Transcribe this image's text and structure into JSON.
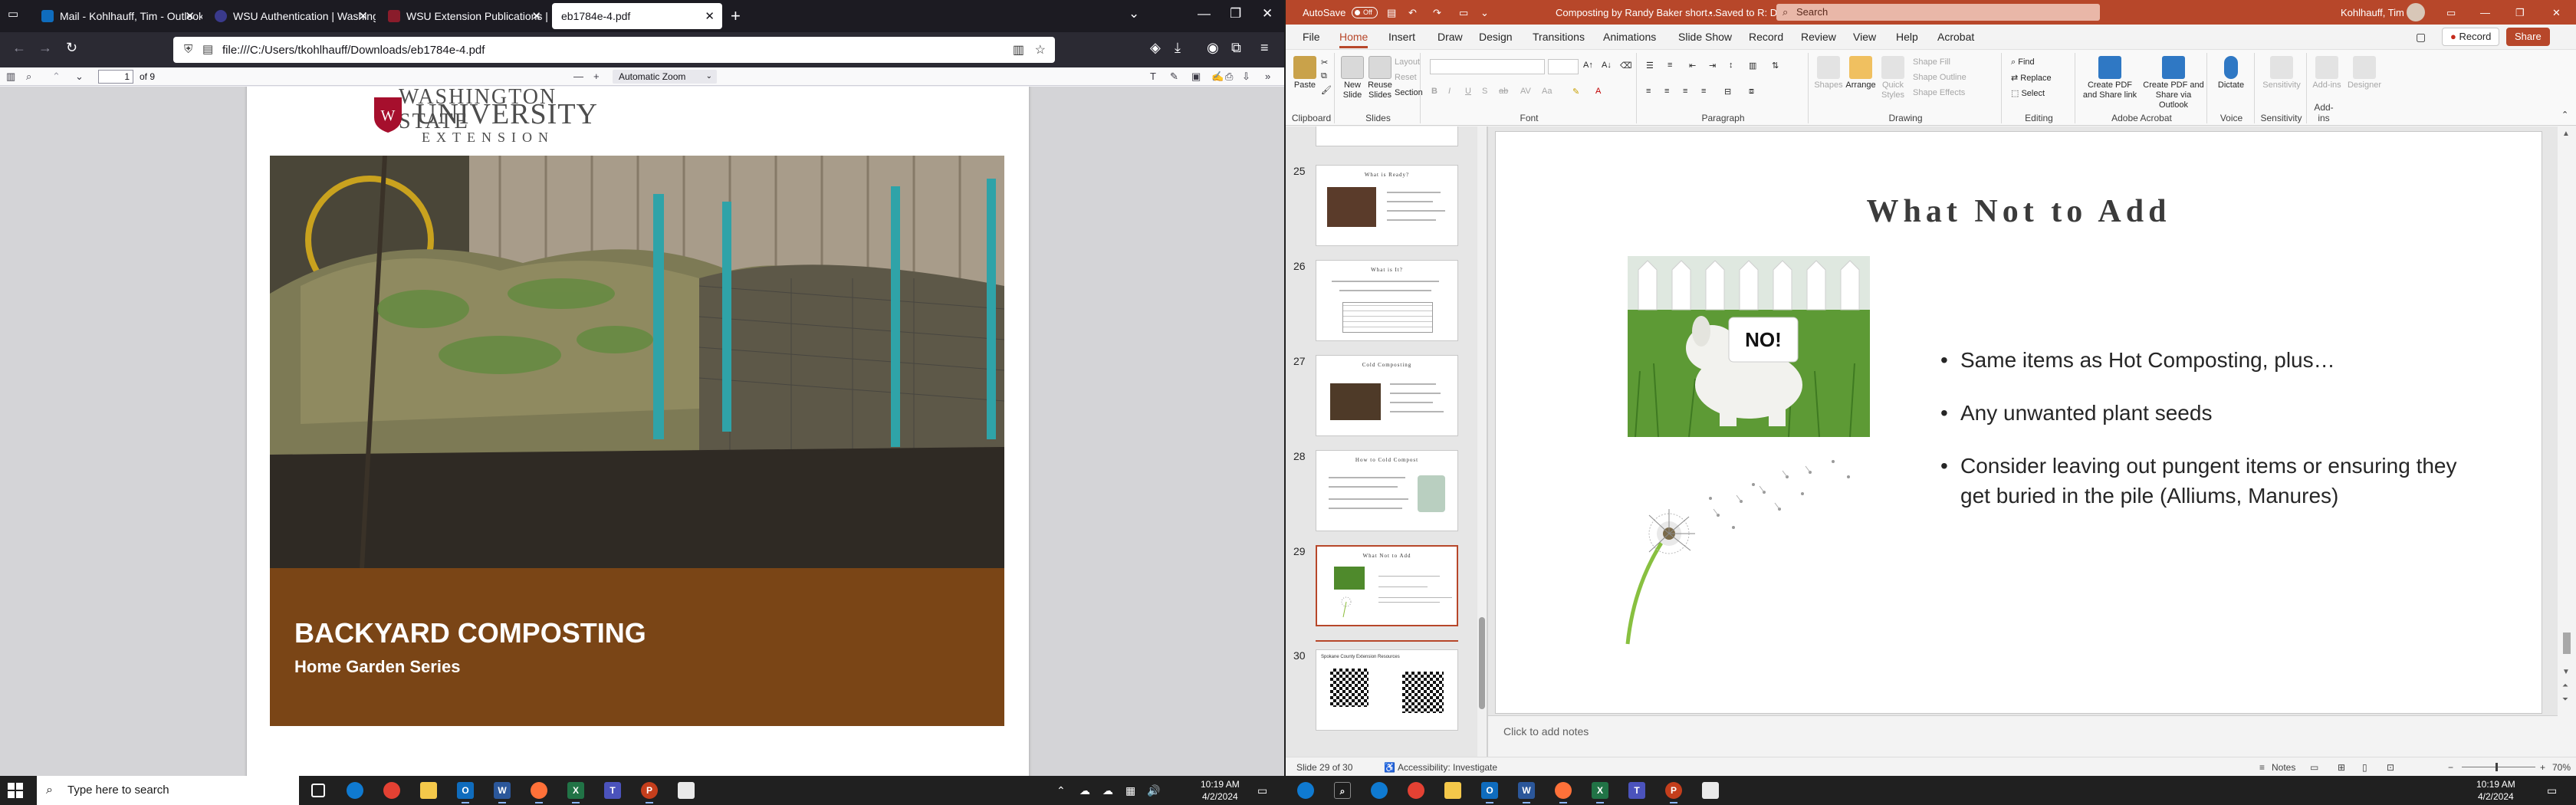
{
  "firefox": {
    "tabs": [
      {
        "label": "Mail - Kohlhauff, Tim - Outlook",
        "color": "#0f6cbd"
      },
      {
        "label": "WSU Authentication | Washington",
        "color": "#3a3a8c"
      },
      {
        "label": "WSU Extension Publications | Bo",
        "color": "#8a1c2b"
      },
      {
        "label": "eb1784e-4.pdf",
        "color": "#c9c9c9"
      }
    ],
    "url": "file:///C:/Users/tkohlhauff/Downloads/eb1784e-4.pdf",
    "pdf_toolbar": {
      "page_number": "1",
      "page_total": "of 9",
      "zoom": "Automatic Zoom"
    },
    "pdf_page": {
      "logo_line1": "WASHINGTON STATE",
      "logo_line2": "UNIVERSITY",
      "logo_line3": "EXTENSION",
      "title": "BACKYARD COMPOSTING",
      "subtitle": "Home Garden Series",
      "band_color": "#7a4516"
    }
  },
  "powerpoint": {
    "autosave_label": "AutoSave",
    "autosave_state": "Off",
    "doc_title": "Composting by Randy Baker short...",
    "saved_status": "• Saved to R: Drive",
    "search_placeholder": "Search",
    "user_name": "Kohlhauff, Tim",
    "menu": [
      "File",
      "Home",
      "Insert",
      "Draw",
      "Design",
      "Transitions",
      "Animations",
      "Slide Show",
      "Record",
      "Review",
      "View",
      "Help",
      "Acrobat"
    ],
    "active_menu": "Home",
    "record_button": "Record",
    "share_button": "Share",
    "ribbon": {
      "clipboard": {
        "label": "Clipboard",
        "paste": "Paste"
      },
      "slides": {
        "label": "Slides",
        "new_slide": "New Slide",
        "reuse": "Reuse Slides",
        "layout": "Layout",
        "reset": "Reset",
        "section": "Section"
      },
      "font": {
        "label": "Font"
      },
      "paragraph": {
        "label": "Paragraph"
      },
      "drawing": {
        "label": "Drawing",
        "shapes": "Shapes",
        "arrange": "Arrange",
        "quick_styles": "Quick Styles",
        "fill": "Shape Fill",
        "outline": "Shape Outline",
        "effects": "Shape Effects"
      },
      "editing": {
        "label": "Editing",
        "find": "Find",
        "replace": "Replace",
        "select": "Select"
      },
      "acrobat": {
        "label": "Adobe Acrobat",
        "create_share": "Create PDF and Share link",
        "create_outlook": "Create PDF and Share via Outlook"
      },
      "voice": {
        "label": "Voice",
        "dictate": "Dictate"
      },
      "sensitivity": {
        "label": "Sensitivity",
        "btn": "Sensitivity"
      },
      "addins": {
        "label": "Add-ins",
        "btn": "Add-ins",
        "designer": "Designer"
      }
    },
    "thumbnails": [
      {
        "num": "25",
        "title": "What is Ready?"
      },
      {
        "num": "26",
        "title": "What is It?"
      },
      {
        "num": "27",
        "title": "Cold Composting"
      },
      {
        "num": "28",
        "title": "How to Cold Compost"
      },
      {
        "num": "29",
        "title": "What Not to Add"
      },
      {
        "num": "30",
        "title": "Spokane County Extension Resources"
      }
    ],
    "selected_slide": "29",
    "slide": {
      "title": "What Not to Add",
      "sign_text": "NO!",
      "bullets": [
        "Same items as Hot Composting, plus…",
        "Any unwanted plant seeds",
        "Consider leaving out pungent items or ensuring they get buried in the pile (Alliums, Manures)"
      ]
    },
    "notes_placeholder": "Click to add notes",
    "status": {
      "slide_count": "Slide 29 of 30",
      "accessibility": "Accessibility: Investigate",
      "notes_button": "Notes",
      "zoom": "70%"
    }
  },
  "taskbar": {
    "search_placeholder": "Type here to search",
    "time": "10:19 AM",
    "date": "4/2/2024",
    "time2": "10:19 AM",
    "date2": "4/2/2024"
  }
}
